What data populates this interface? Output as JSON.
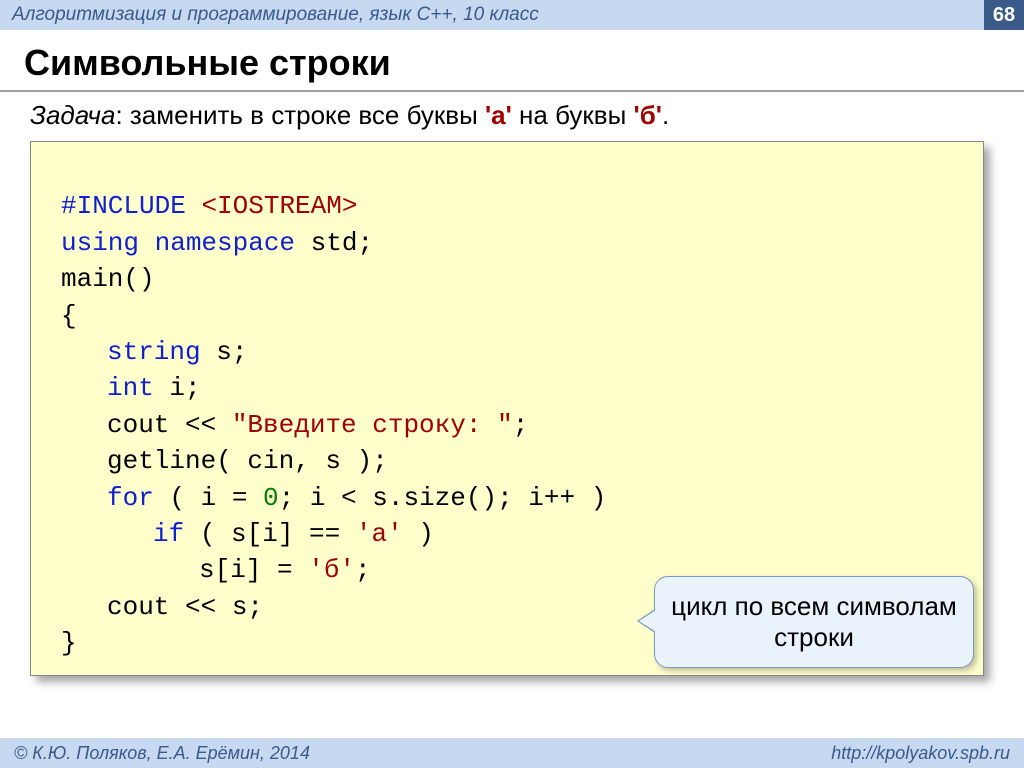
{
  "header": {
    "subtitle": "Алгоритмизация и программирование, язык C++, 10 класс",
    "page": "68"
  },
  "title": "Символьные строки",
  "task": {
    "label": "Задача",
    "text": ": заменить в строке все буквы ",
    "a": "'а'",
    "mid": " на буквы ",
    "b": "'б'",
    "end": "."
  },
  "code": {
    "l1a": "#INCLUDE ",
    "l1b": "<IOSTREAM>",
    "l2a": "using namespace ",
    "l2b": "std;",
    "l3": "main()",
    "l4": "{",
    "l5a": "string",
    "l5b": " s;",
    "l6a": "int",
    "l6b": " i;",
    "l7a": "cout << ",
    "l7b": "\"Введите строку: \"",
    "l7c": ";",
    "l8": "getline( cin, s );",
    "l9a": "for",
    "l9b": " ( i = ",
    "l9c": "0",
    "l9d": "; i < s.size(); i++ )",
    "l10a": "if",
    "l10b": " ( s[i] == ",
    "l10c": "'а'",
    "l10d": " )",
    "l11a": "s[i] = ",
    "l11b": "'б'",
    "l11c": ";",
    "l12": "cout << s;",
    "l13": "}"
  },
  "callout": "цикл по всем символам строки",
  "footer": {
    "left": "© К.Ю. Поляков, Е.А. Ерёмин, 2014",
    "right": "http://kpolyakov.spb.ru"
  }
}
